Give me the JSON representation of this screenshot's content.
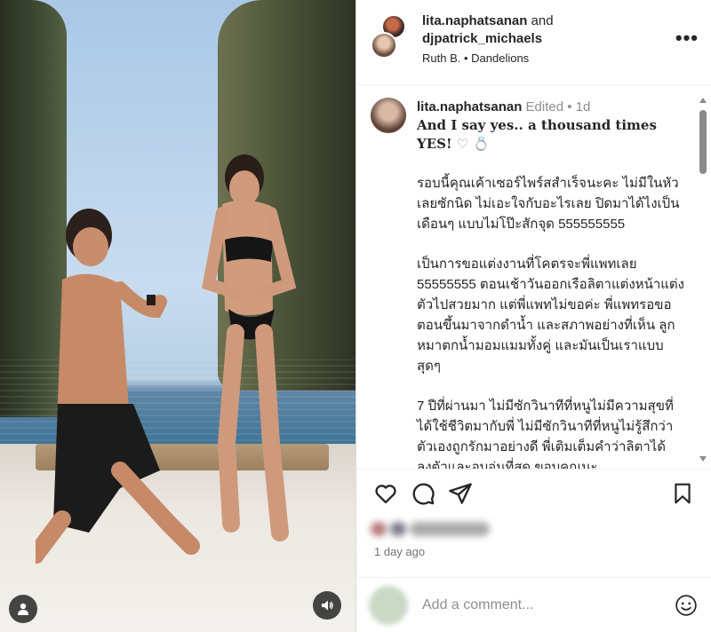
{
  "post": {
    "author": "lita.naphatsanan",
    "and_text": "and",
    "collaborator": "djpatrick_michaels",
    "audio": "Ruth B. • Dandelions",
    "more": "•••"
  },
  "caption": {
    "username": "lita.naphatsanan",
    "edited": "Edited",
    "dot": "•",
    "age": "1d",
    "lead": "And I say yes.. a thousand times YES!",
    "lead_emoji": "♡ 💍",
    "paragraphs": [
      "รอบนี้คุณเค้าเซอร์ไพร์สสำเร็จนะคะ ไม่มีในหัวเลยซักนิด ไม่เอะใจกับอะไรเลย ปิดมาได้ไงเป็นเดือนๆ แบบไม่โป๊ะสักจุด 555555555",
      "เป็นการขอแต่งงานที่โคตรจะพี่แพทเลย 55555555 ตอนเช้าวันออกเรือลิตาแต่งหน้าแต่งตัวไปสวยมาก แต่พี่แพทไม่ขอค่ะ พี่แพทรอขอตอนขึ้นมาจากดำน้ำ และสภาพอย่างที่เห็น ลูกหมาตกน้ำมอมแมมทั้งคู่ และมันเป็นเราแบบสุดๆ",
      "7 ปีที่ผ่านมา ไม่มีซักวินาทีที่หนูไม่มีความสุขที่ได้ใช้ชีวิตมากับพี่ ไม่มีซักวินาทีที่หนูไม่รู้สึกว่าตัวเองถูกรักมาอย่างดี พี่เติมเต็มคำว่าลิตาได้ลงตัวและอบอุ่นที่สุด ขอบคุณนะ"
    ]
  },
  "actions": {
    "like_icon": "heart-icon",
    "comment_icon": "comment-icon",
    "share_icon": "share-icon",
    "save_icon": "bookmark-icon"
  },
  "time_ago": "1 day ago",
  "comment": {
    "placeholder": "Add a comment..."
  },
  "media": {
    "user_tag_icon": "user-icon",
    "audio_icon": "speaker-icon"
  }
}
